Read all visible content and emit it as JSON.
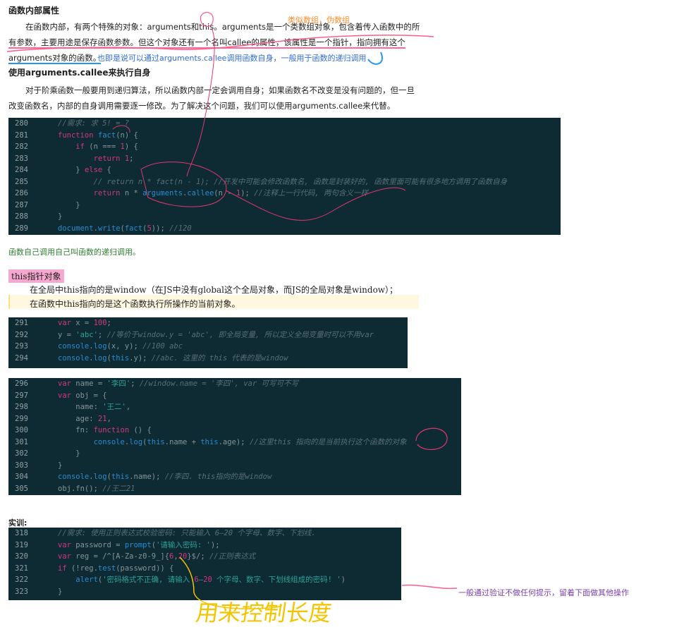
{
  "section1": {
    "title": "函数内部属性",
    "para_a": "在函数内部，有两个特殊的对象：arguments和this。arguments是一个类数组对象，包含着传入函数中的所",
    "para_b": "有参数，主要用途是保存函数参数。但这个对象还有一个名叫callee的属性，该属性是一个指针，指向拥有这个",
    "para_c": "arguments对象的函数。"
  },
  "annotations": {
    "orange": "类似数组，伪数组",
    "blue": "也即是说可以通过arguments.callee调用函数自身，一般用于函数的递归调用",
    "green": "函数自己调用自己叫函数的递归调用。",
    "purple": "一般通过验证不做任何提示，留着下面做其他操作",
    "handwriting": "用来控制长度"
  },
  "section2": {
    "title": "使用arguments.callee来执行自身",
    "para_a": "对于阶乘函数一般要用到递归算法，所以函数内部一定会调用自身；如果函数名不改变是没有问题的，但一旦",
    "para_b": "改变函数名，内部的自身调用需要逐一修改。为了解决这个问题，我们可以使用arguments.callee来代替。"
  },
  "code1": [
    {
      "n": "280",
      "t": "    //需求: 求 5! = ?"
    },
    {
      "n": "281",
      "t": "    function fact(n) {"
    },
    {
      "n": "282",
      "t": "        if (n === 1) {"
    },
    {
      "n": "283",
      "t": "            return 1;"
    },
    {
      "n": "284",
      "t": "        } else {"
    },
    {
      "n": "285",
      "t": "            // return n * fact(n - 1); //开发中可能会修改函数名, 函数是封装好的, 函数里面可能有很多地方调用了函数自身"
    },
    {
      "n": "286",
      "t": "            return n * arguments.callee(n - 1); //注释上一行代码, 两句含义一样"
    },
    {
      "n": "287",
      "t": "        }"
    },
    {
      "n": "288",
      "t": "    }"
    },
    {
      "n": "289",
      "t": "    document.write(fact(5)); //120"
    }
  ],
  "section3": {
    "title": "this指针对象",
    "line_a": "在全局中this指向的是window（在JS中没有global这个全局对象，而JS的全局对象是window）；",
    "line_b": "在函数中this指向的是这个函数执行所操作的当前对象。"
  },
  "code2": [
    {
      "n": "291",
      "t": "    var x = 100;"
    },
    {
      "n": "292",
      "t": "    y = 'abc'; //等价于window.y = 'abc', 即全局变量, 所以定义全局变量时可以不用var"
    },
    {
      "n": "293",
      "t": "    console.log(x, y); //100 abc"
    },
    {
      "n": "294",
      "t": "    console.log(this.y); //abc. 这里的 this 代表的是window"
    }
  ],
  "code3": [
    {
      "n": "296",
      "t": "    var name = '李四'; //window.name = '李四', var 可写可不写"
    },
    {
      "n": "297",
      "t": "    var obj = {"
    },
    {
      "n": "298",
      "t": "        name: '王二',"
    },
    {
      "n": "299",
      "t": "        age: 21,"
    },
    {
      "n": "300",
      "t": "        fn: function () {"
    },
    {
      "n": "301",
      "t": "            console.log(this.name + this.age); //这里this 指向的是当前执行这个函数的对象"
    },
    {
      "n": "302",
      "t": "        }"
    },
    {
      "n": "303",
      "t": "    }"
    },
    {
      "n": "304",
      "t": "    console.log(this.name); //李四. this指向的是window"
    },
    {
      "n": "305",
      "t": "    obj.fn(); //王二21"
    }
  ],
  "section4": {
    "title": "实训:"
  },
  "code4": [
    {
      "n": "318",
      "t": "    //需求: 使用正则表达式校验密码: 只能输入 6—20 个字母、数字、下划线."
    },
    {
      "n": "319",
      "t": "    var password = prompt('请输入密码: ');"
    },
    {
      "n": "320",
      "t": "    var reg = /^[A-Za-z0-9_]{6,20}$/; //正则表达式"
    },
    {
      "n": "321",
      "t": "    if (!reg.test(password)) {"
    },
    {
      "n": "322",
      "t": "        alert('密码格式不正确, 请输入 6—20 个字母、数字、下划线组成的密码! ')"
    },
    {
      "n": "323",
      "t": "    }"
    }
  ]
}
